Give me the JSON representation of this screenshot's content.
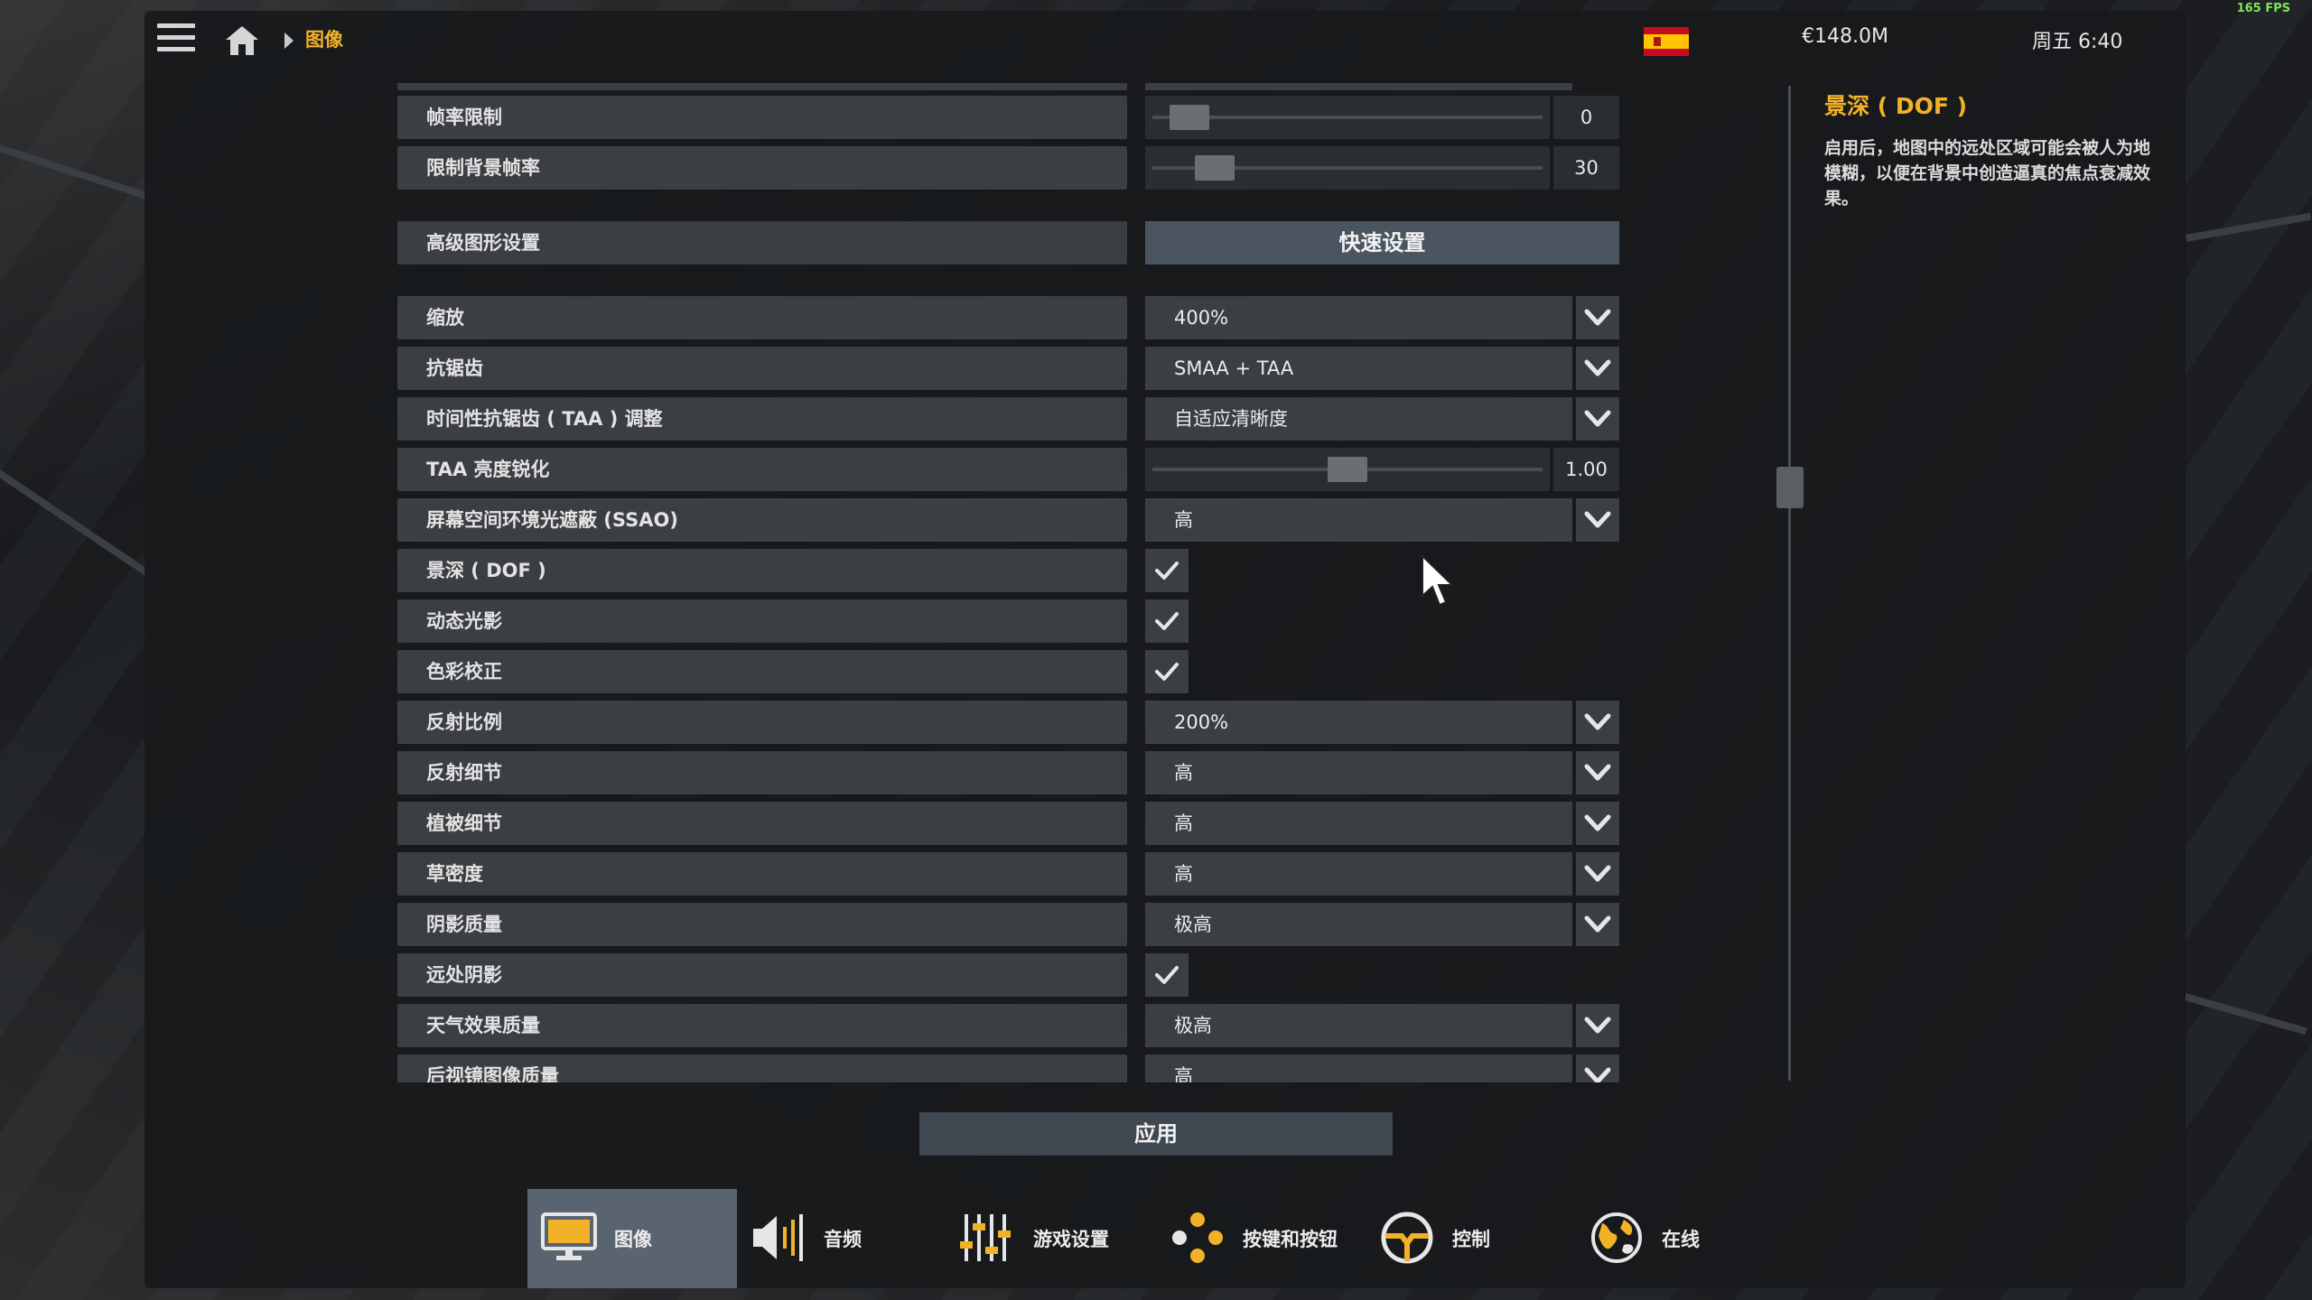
{
  "fps": "165 FPS",
  "header": {
    "breadcrumb": "图像",
    "money": "€148.0M",
    "clock": "周五 6:40"
  },
  "settings": {
    "frame_limit": {
      "label": "帧率限制",
      "value": "0",
      "level": 0.05
    },
    "bg_frame_limit": {
      "label": "限制背景帧率",
      "value": "30",
      "level": 0.12
    },
    "advanced": {
      "label": "高级图形设置",
      "button": "快速设置"
    },
    "scale": {
      "label": "缩放",
      "value": "400%"
    },
    "antialias": {
      "label": "抗锯齿",
      "value": "SMAA + TAA"
    },
    "taa_adjust": {
      "label": "时间性抗锯齿 ( TAA ) 调整",
      "value": "自适应清晰度"
    },
    "taa_sharpen": {
      "label": "TAA 亮度锐化",
      "value": "1.00",
      "level": 0.5
    },
    "ssao": {
      "label": "屏幕空间环境光遮蔽 (SSAO)",
      "value": "高"
    },
    "dof": {
      "label": "景深 ( DOF )",
      "checked": true
    },
    "dynamic_light": {
      "label": "动态光影",
      "checked": true
    },
    "color_correction": {
      "label": "色彩校正",
      "checked": true
    },
    "reflection_scale": {
      "label": "反射比例",
      "value": "200%"
    },
    "reflection_detail": {
      "label": "反射细节",
      "value": "高"
    },
    "vegetation_detail": {
      "label": "植被细节",
      "value": "高"
    },
    "grass_density": {
      "label": "草密度",
      "value": "高"
    },
    "shadow_quality": {
      "label": "阴影质量",
      "value": "极高"
    },
    "far_shadows": {
      "label": "远处阴影",
      "checked": true
    },
    "weather_quality": {
      "label": "天气效果质量",
      "value": "极高"
    },
    "mirror_quality": {
      "label": "后视镜图像质量",
      "value": "高"
    }
  },
  "description": {
    "title": "景深 ( DOF )",
    "text": "启用后，地图中的远处区域可能会被人为地模糊，以便在背景中创造逼真的焦点衰减效果。"
  },
  "apply_label": "应用",
  "tabs": [
    {
      "label": "图像",
      "icon": "monitor-icon",
      "active": true
    },
    {
      "label": "音频",
      "icon": "speaker-icon",
      "active": false
    },
    {
      "label": "游戏设置",
      "icon": "sliders-icon",
      "active": false
    },
    {
      "label": "按键和按钮",
      "icon": "gamepad-buttons-icon",
      "active": false
    },
    {
      "label": "控制",
      "icon": "steering-wheel-icon",
      "active": false
    },
    {
      "label": "在线",
      "icon": "globe-icon",
      "active": false
    }
  ],
  "colors": {
    "accent": "#f2b227",
    "row": "#3b3e42",
    "active_tab": "#5a6470"
  }
}
